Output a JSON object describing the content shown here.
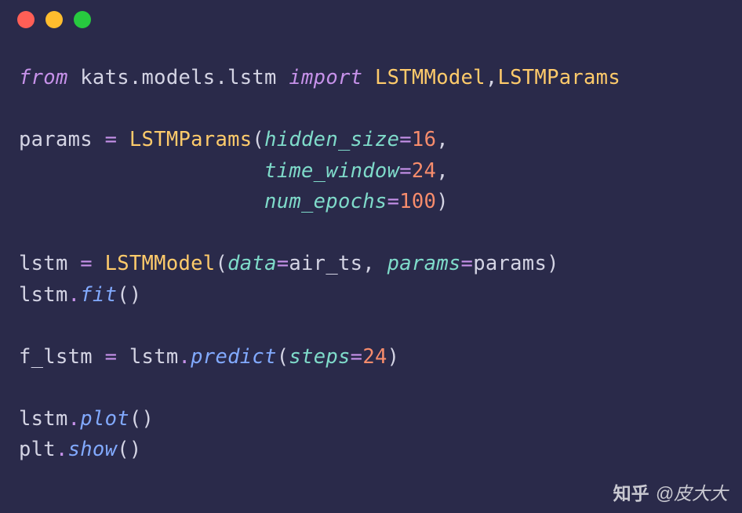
{
  "code": {
    "line1": {
      "from": "from",
      "module": "kats.models.lstm",
      "import": "import",
      "cls1": "LSTMModel",
      "comma": ",",
      "cls2": "LSTMParams"
    },
    "line3": {
      "var": "params",
      "eq": "=",
      "cls": "LSTMParams",
      "open": "(",
      "p1": "hidden_size",
      "peq": "=",
      "v1": "16",
      "comma": ","
    },
    "line4": {
      "indent": "                    ",
      "p2": "time_window",
      "peq": "=",
      "v2": "24",
      "comma": ","
    },
    "line5": {
      "indent": "                    ",
      "p3": "num_epochs",
      "peq": "=",
      "v3": "100",
      "close": ")"
    },
    "line7": {
      "var": "lstm",
      "eq": "=",
      "cls": "LSTMModel",
      "open": "(",
      "p1": "data",
      "peq": "=",
      "v1": "air_ts",
      "comma": ",",
      "p2": "params",
      "v2": "params",
      "close": ")"
    },
    "line8": {
      "obj": "lstm",
      "dot": ".",
      "fn": "fit",
      "open": "(",
      "close": ")"
    },
    "line10": {
      "var": "f_lstm",
      "eq": "=",
      "obj": "lstm",
      "dot": ".",
      "fn": "predict",
      "open": "(",
      "p1": "steps",
      "peq": "=",
      "v1": "24",
      "close": ")"
    },
    "line12": {
      "obj": "lstm",
      "dot": ".",
      "fn": "plot",
      "open": "(",
      "close": ")"
    },
    "line13": {
      "obj": "plt",
      "dot": ".",
      "fn": "show",
      "open": "(",
      "close": ")"
    }
  },
  "watermark": {
    "logo": "知乎",
    "at": "@皮大大"
  }
}
